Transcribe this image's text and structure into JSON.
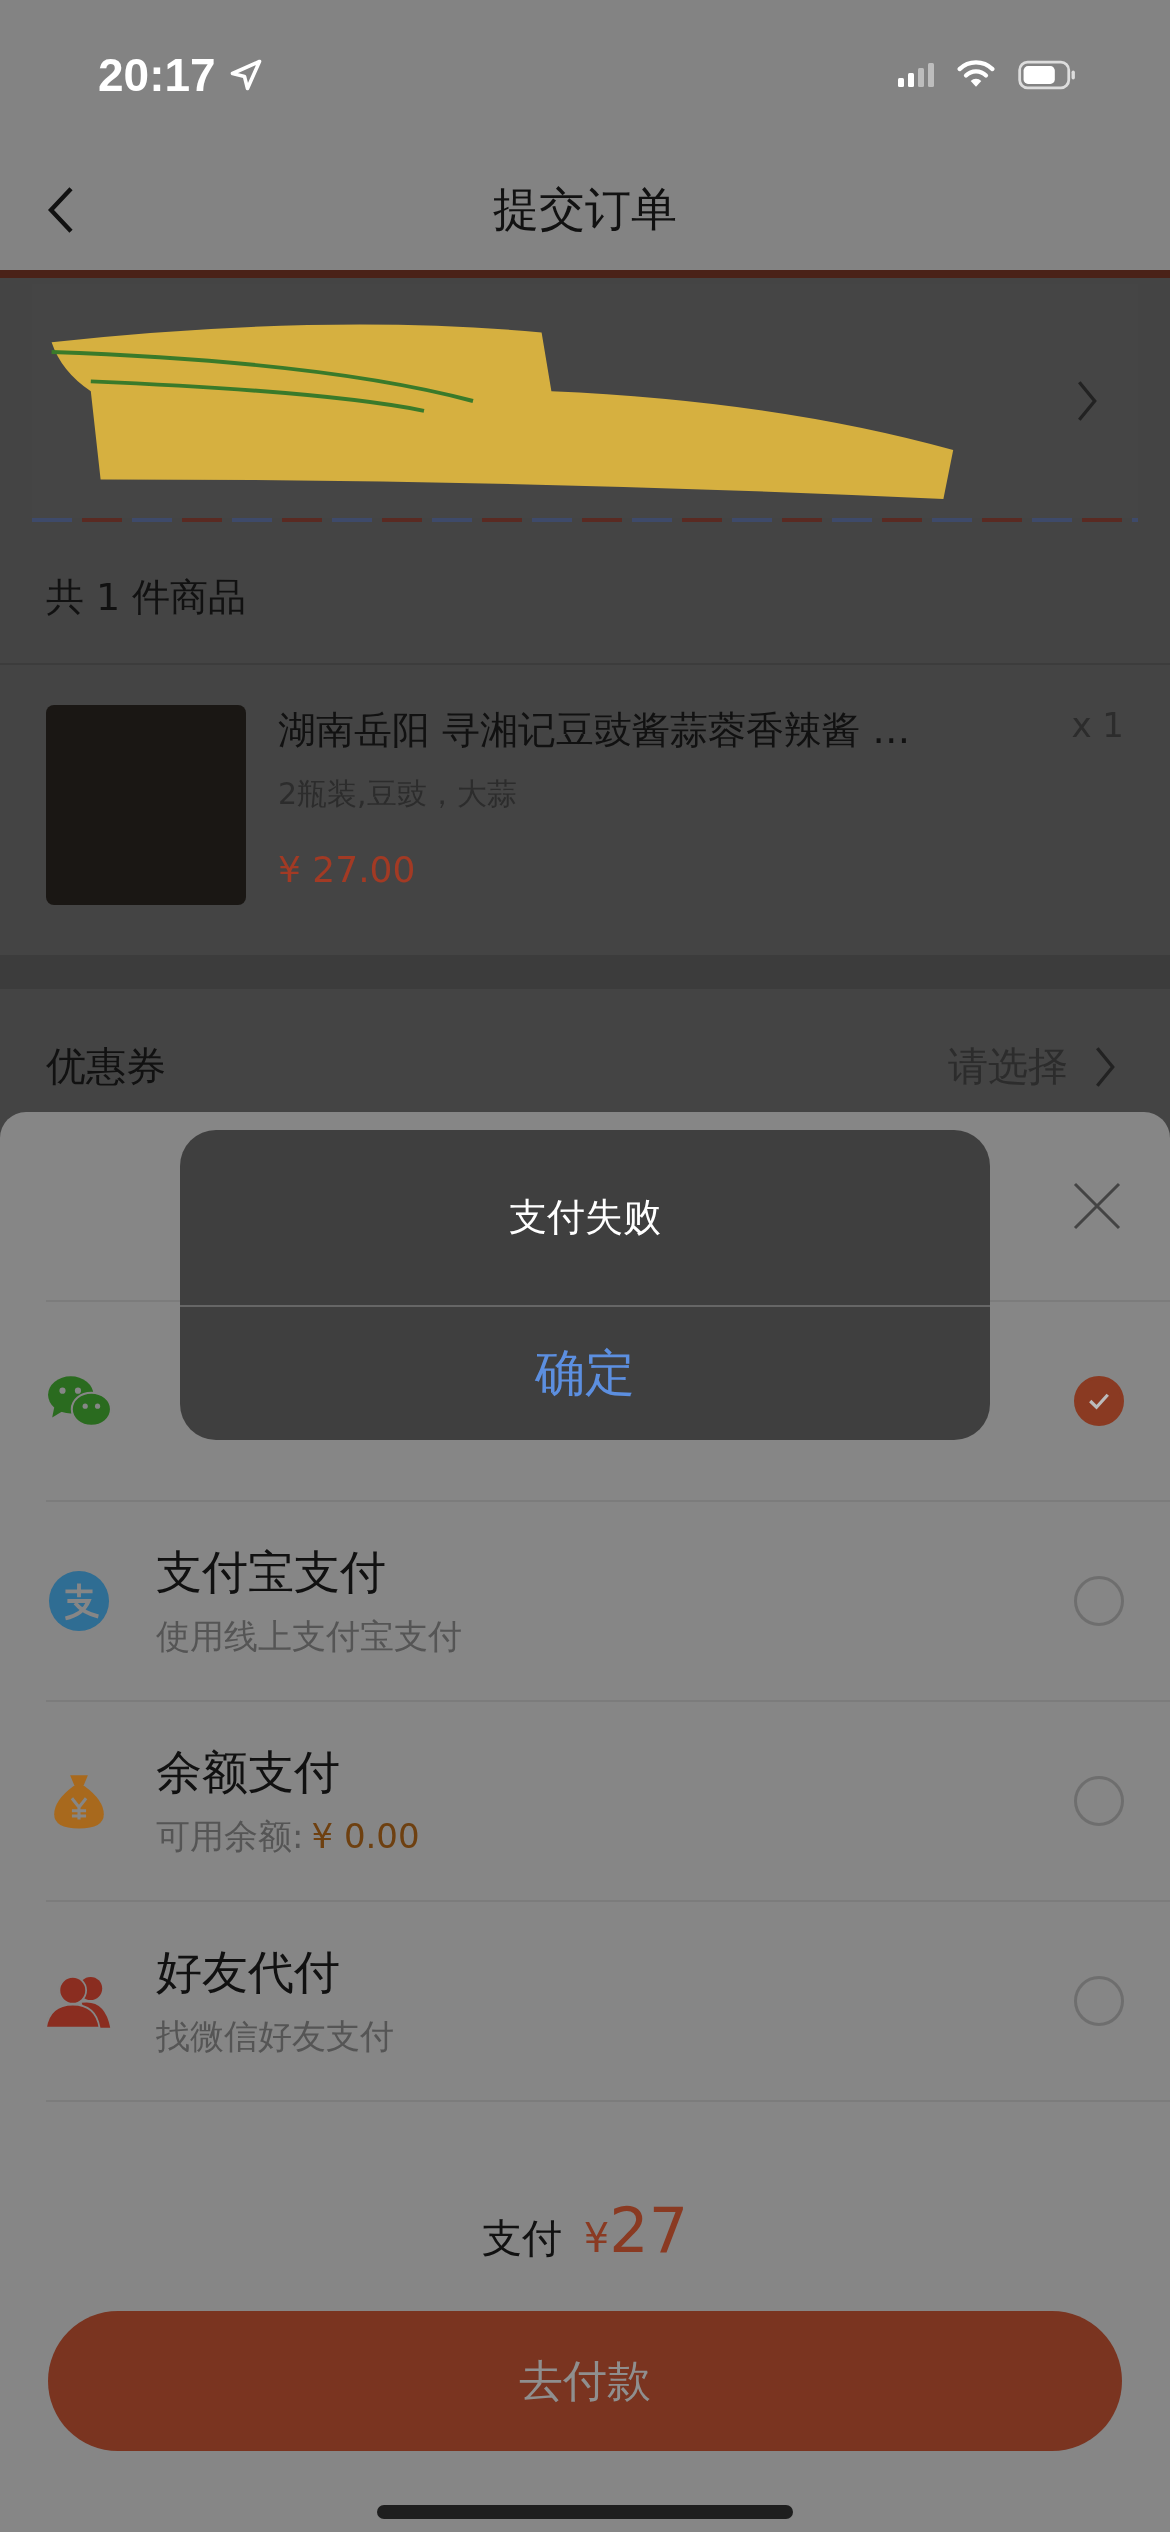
{
  "status_bar": {
    "time": "20:17"
  },
  "nav": {
    "title": "提交订单"
  },
  "order": {
    "count_label": "共 1 件商品"
  },
  "product": {
    "title": "湖南岳阳 寻湘记豆豉酱蒜蓉香辣酱 …",
    "spec": "2瓶装,豆豉，大蒜",
    "price": "¥ 27.00",
    "quantity": "x 1"
  },
  "coupon": {
    "label": "优惠券",
    "value": "请选择"
  },
  "payment_sheet": {
    "methods": [
      {
        "kind": "wechat",
        "selected": true
      },
      {
        "kind": "alipay",
        "title": "支付宝支付",
        "subtitle": "使用线上支付宝支付",
        "selected": false
      },
      {
        "kind": "balance",
        "title": "余额支付",
        "subtitle": "可用余额:",
        "amount": "¥ 0.00",
        "selected": false
      },
      {
        "kind": "friend",
        "title": "好友代付",
        "subtitle": "找微信好友支付",
        "selected": false
      }
    ],
    "total_label": "支付",
    "total_currency": "¥",
    "total_amount": "27",
    "pay_button": "去付款"
  },
  "dialog": {
    "message": "支付失败",
    "confirm": "确定"
  }
}
